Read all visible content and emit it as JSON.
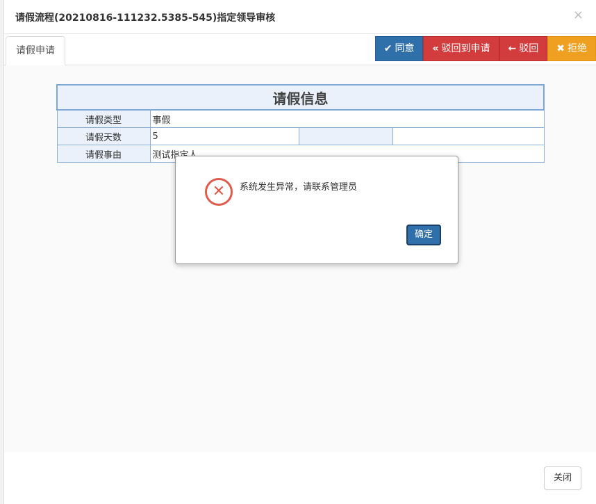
{
  "modal": {
    "title": "请假流程(20210816-111232.5385-545)指定领导审核",
    "close_glyph": "×"
  },
  "tab": {
    "label": "请假申请"
  },
  "actions": [
    {
      "icon": "✔",
      "label": "同意",
      "icon_name": "check-icon"
    },
    {
      "icon": "«",
      "label": "驳回到申请",
      "icon_name": "double-left-icon"
    },
    {
      "icon": "←",
      "label": "驳回",
      "icon_name": "arrow-left-icon"
    },
    {
      "icon": "✖",
      "label": "拒绝",
      "icon_name": "x-icon"
    }
  ],
  "info": {
    "title": "请假信息",
    "rows": [
      {
        "label": "请假类型",
        "value": "事假"
      },
      {
        "label": "请假天数",
        "value": "5"
      },
      {
        "label": "请假事由",
        "value": "测试指定人"
      }
    ]
  },
  "alert": {
    "icon": "✕",
    "message": "系统发生异常，请联系管理员",
    "ok_label": "确定"
  },
  "footer": {
    "close_label": "关闭"
  },
  "colors": {
    "primary": "#2f6faa",
    "danger": "#d33c3c",
    "warning": "#f0a020",
    "error_icon": "#e05b4b"
  }
}
